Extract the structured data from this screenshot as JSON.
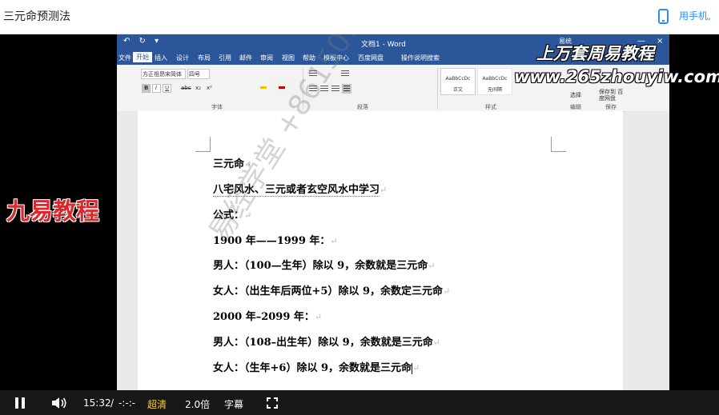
{
  "header": {
    "title": "三元命预测法",
    "mobile_link": "用手机,"
  },
  "word": {
    "qat": "↶ ↻ ▾",
    "doc_title": "文档1 - Word",
    "user": "易统",
    "window_controls": [
      "—",
      "×"
    ],
    "tabs": [
      "文件",
      "开始",
      "插入",
      "设计",
      "布局",
      "引用",
      "邮件",
      "审阅",
      "视图",
      "帮助",
      "模板中心",
      "百度网盘",
      "操作说明搜索"
    ],
    "active_tab": "开始",
    "ribbon": {
      "font_name": "方正祖昂宋简体",
      "font_size": "四号",
      "font_btns": [
        "B",
        "I",
        "U",
        "abc",
        "x₂",
        "x²"
      ],
      "group_font": "字体",
      "group_paragraph": "段落",
      "group_styles": "样式",
      "group_edit": "编辑",
      "group_save": "保存",
      "styles": [
        "AaBbCcDc",
        "AaBbCcDc"
      ],
      "style_names": [
        "正文",
        "无间隔"
      ],
      "select": "选择",
      "baidu_save": "保存到 百度网盘"
    },
    "document_lines": [
      "三元命",
      "八宅风水、三元或者玄空风水中学习",
      "公式：",
      "1900 年——1999 年：",
      "男人：（100—生年）除以 9，余数就是三元命",
      "女人：（出生年后两位+5）除以 9，余数定三元命",
      "2000 年–2099 年：",
      "男人：（108–出生年）除以 9，余数就是三元命",
      "女人：（生年+6）除以 9，余数就是三元命"
    ],
    "paragraph_mark": "↵"
  },
  "watermarks": {
    "top_right": "上万套周易教程",
    "url": "www.265zhouyiw.com",
    "left": "九易教程",
    "diagonal": "易经学堂 +8615011267424"
  },
  "player": {
    "time": "15:32",
    "separator": "/",
    "duration": "-:-:-",
    "quality": "超清",
    "speed": "2.0倍",
    "subtitle": "字幕",
    "accent": "#ffcf2d",
    "icons": [
      "pause-icon",
      "volume-icon",
      "fullscreen-icon"
    ]
  }
}
